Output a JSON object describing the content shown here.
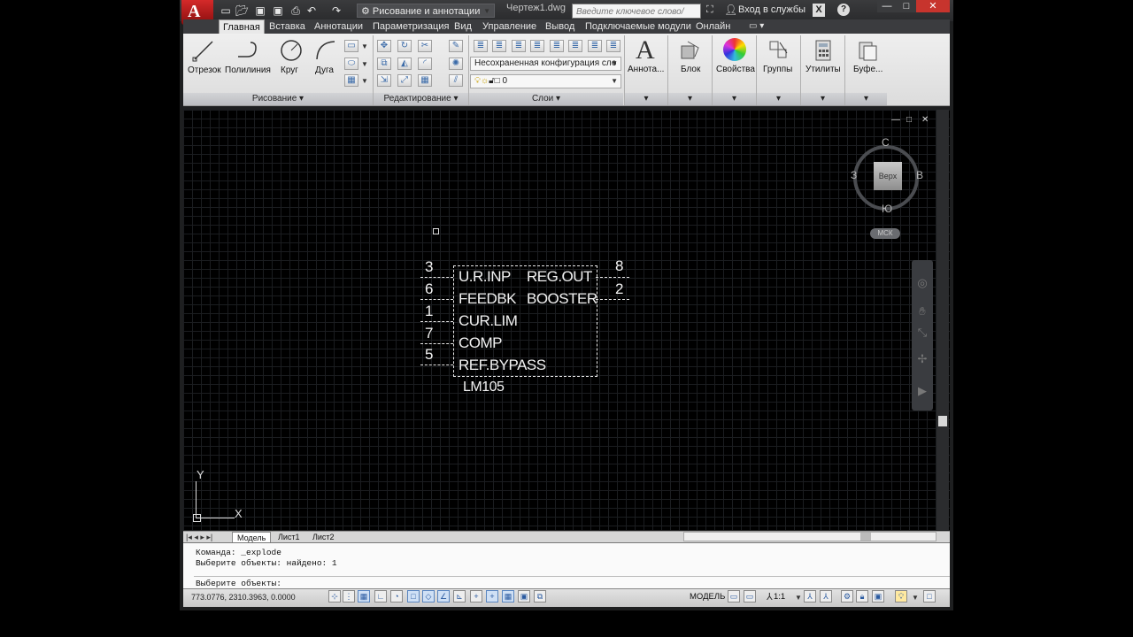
{
  "app": {
    "logo_letter": "A",
    "workspace": "Рисование и аннотации",
    "doc_title": "Чертеж1.dwg",
    "search_placeholder": "Введите ключевое слово/фразу",
    "signin": "Вход в службы",
    "window_buttons": [
      "—",
      "□",
      "✕"
    ],
    "help": "?"
  },
  "tabs": [
    {
      "label": "Главная",
      "active": true
    },
    {
      "label": "Вставка"
    },
    {
      "label": "Аннотации"
    },
    {
      "label": "Параметризация"
    },
    {
      "label": "Вид"
    },
    {
      "label": "Управление"
    },
    {
      "label": "Вывод"
    },
    {
      "label": "Подключаемые модули"
    },
    {
      "label": "Онлайн"
    }
  ],
  "ribbon": {
    "draw": {
      "label": "Рисование ▾",
      "tools": [
        "Отрезок",
        "Полилиния",
        "Круг",
        "Дуга"
      ]
    },
    "modify": {
      "label": "Редактирование ▾"
    },
    "layers": {
      "label": "Слои ▾",
      "state_dropdown": "Несохраненная конфигурация сло",
      "layer_value": "0"
    },
    "big_buttons": [
      "Аннота...",
      "Блок",
      "Свойства",
      "Группы",
      "Утилиты",
      "Буфе..."
    ]
  },
  "viewport": {
    "controls": [
      "—",
      "□",
      "✕"
    ],
    "viewcube": {
      "top": "Верх",
      "north": "С",
      "south": "Ю",
      "east": "В",
      "west": "З",
      "ucs": "МСК"
    }
  },
  "drawing": {
    "left_pins": [
      "3",
      "6",
      "1",
      "7",
      "5"
    ],
    "right_pins": [
      "8",
      "2"
    ],
    "left_labels": [
      "U.R.INP",
      "FEEDBK",
      "CUR.LIM",
      "COMP",
      "REF.BYPASS"
    ],
    "right_labels": [
      "REG.OUT",
      "BOOSTER"
    ],
    "part_name": "LM105",
    "ucs_y": "Y",
    "ucs_x": "X"
  },
  "layout_tabs": [
    "Модель",
    "Лист1",
    "Лист2"
  ],
  "command": {
    "history": [
      "Команда: _explode",
      "Выберите объекты: найдено: 1"
    ],
    "prompt": "Выберите объекты:"
  },
  "status": {
    "coords": "773.0776, 2310.3963, 0.0000",
    "model": "МОДЕЛЬ",
    "scale": "1:1"
  }
}
